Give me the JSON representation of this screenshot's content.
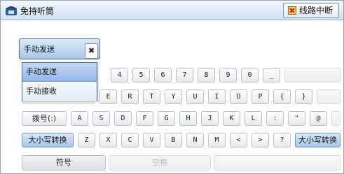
{
  "title": "免持听筒",
  "hangup_button": "线路中断",
  "dropdown": {
    "selected": "手动发送",
    "options": [
      "手动发送",
      "手动接收"
    ]
  },
  "keyboard": {
    "row1": [
      "4",
      "5",
      "6",
      "7",
      "8",
      "9",
      "0",
      "_"
    ],
    "row2": [
      "E",
      "R",
      "T",
      "Y",
      "U",
      "I",
      "O",
      "P",
      "{",
      "}"
    ],
    "row3": [
      "拨号(:)",
      "A",
      "S",
      "D",
      "F",
      "G",
      "H",
      "J",
      "K",
      "L",
      ":",
      "\"",
      "@"
    ],
    "row4": [
      "大小写转换",
      "Z",
      "X",
      "C",
      "V",
      "B",
      "N",
      "M",
      "<",
      ">",
      "?",
      "大小写转换"
    ],
    "symbols": "符号",
    "space": "空格"
  }
}
